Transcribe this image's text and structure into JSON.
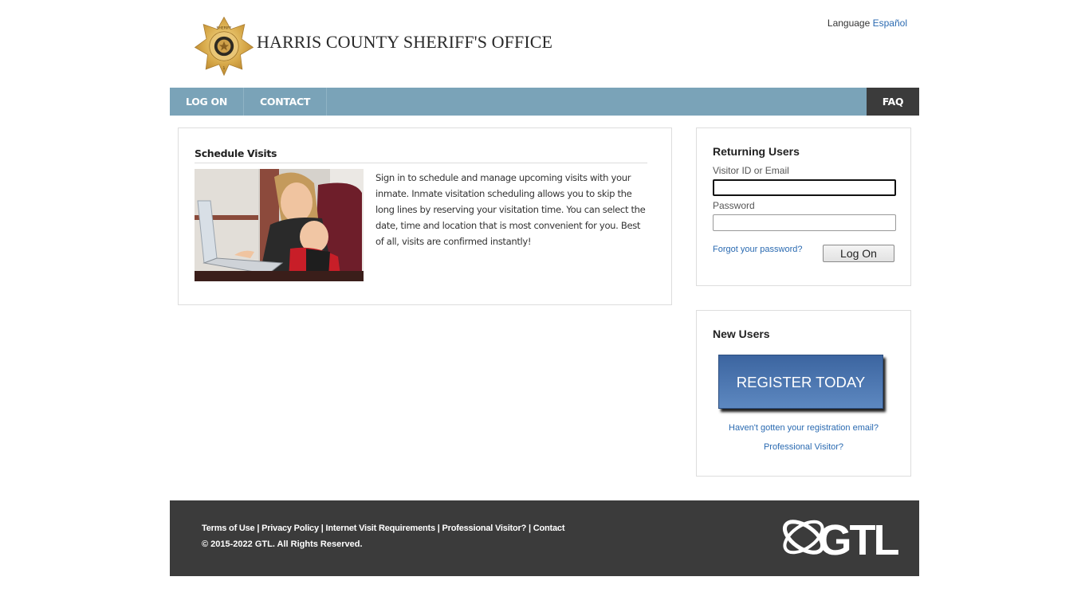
{
  "header": {
    "site_title": "HARRIS COUNTY SHERIFF'S OFFICE",
    "language_label": "Language",
    "language_link": "Español",
    "badge_icon": "sheriff-badge-icon"
  },
  "nav": {
    "items": [
      {
        "label": "LOG ON"
      },
      {
        "label": "CONTACT"
      }
    ],
    "faq_label": "FAQ"
  },
  "schedule": {
    "title": "Schedule Visits",
    "description": "Sign in to schedule and manage upcoming visits with your inmate. Inmate visitation scheduling allows you to skip the long lines by reserving your visitation time. You can select the date, time and location that is most convenient for you. Best of all, visits are confirmed instantly!"
  },
  "returning": {
    "title": "Returning Users",
    "visitor_label": "Visitor ID or Email",
    "visitor_value": "",
    "password_label": "Password",
    "password_value": "",
    "forgot_link": "Forgot your password?",
    "logon_button": "Log On"
  },
  "new_users": {
    "title": "New Users",
    "register_button": "REGISTER TODAY",
    "registration_email_link": "Haven't gotten your registration email?",
    "professional_visitor_link": "Professional Visitor?"
  },
  "footer": {
    "links": [
      "Terms of Use",
      "Privacy Policy",
      "Internet Visit Requirements",
      "Professional Visitor?",
      "Contact"
    ],
    "separator": " | ",
    "copyright": "© 2015-2022 GTL. All Rights Reserved.",
    "logo_text": "GTL"
  },
  "colors": {
    "nav_bg": "#7aa3b8",
    "faq_bg": "#3b3b3b",
    "link": "#2a6ab1",
    "register_bg": "#4a74ad",
    "footer_bg": "#3b3b3b"
  }
}
